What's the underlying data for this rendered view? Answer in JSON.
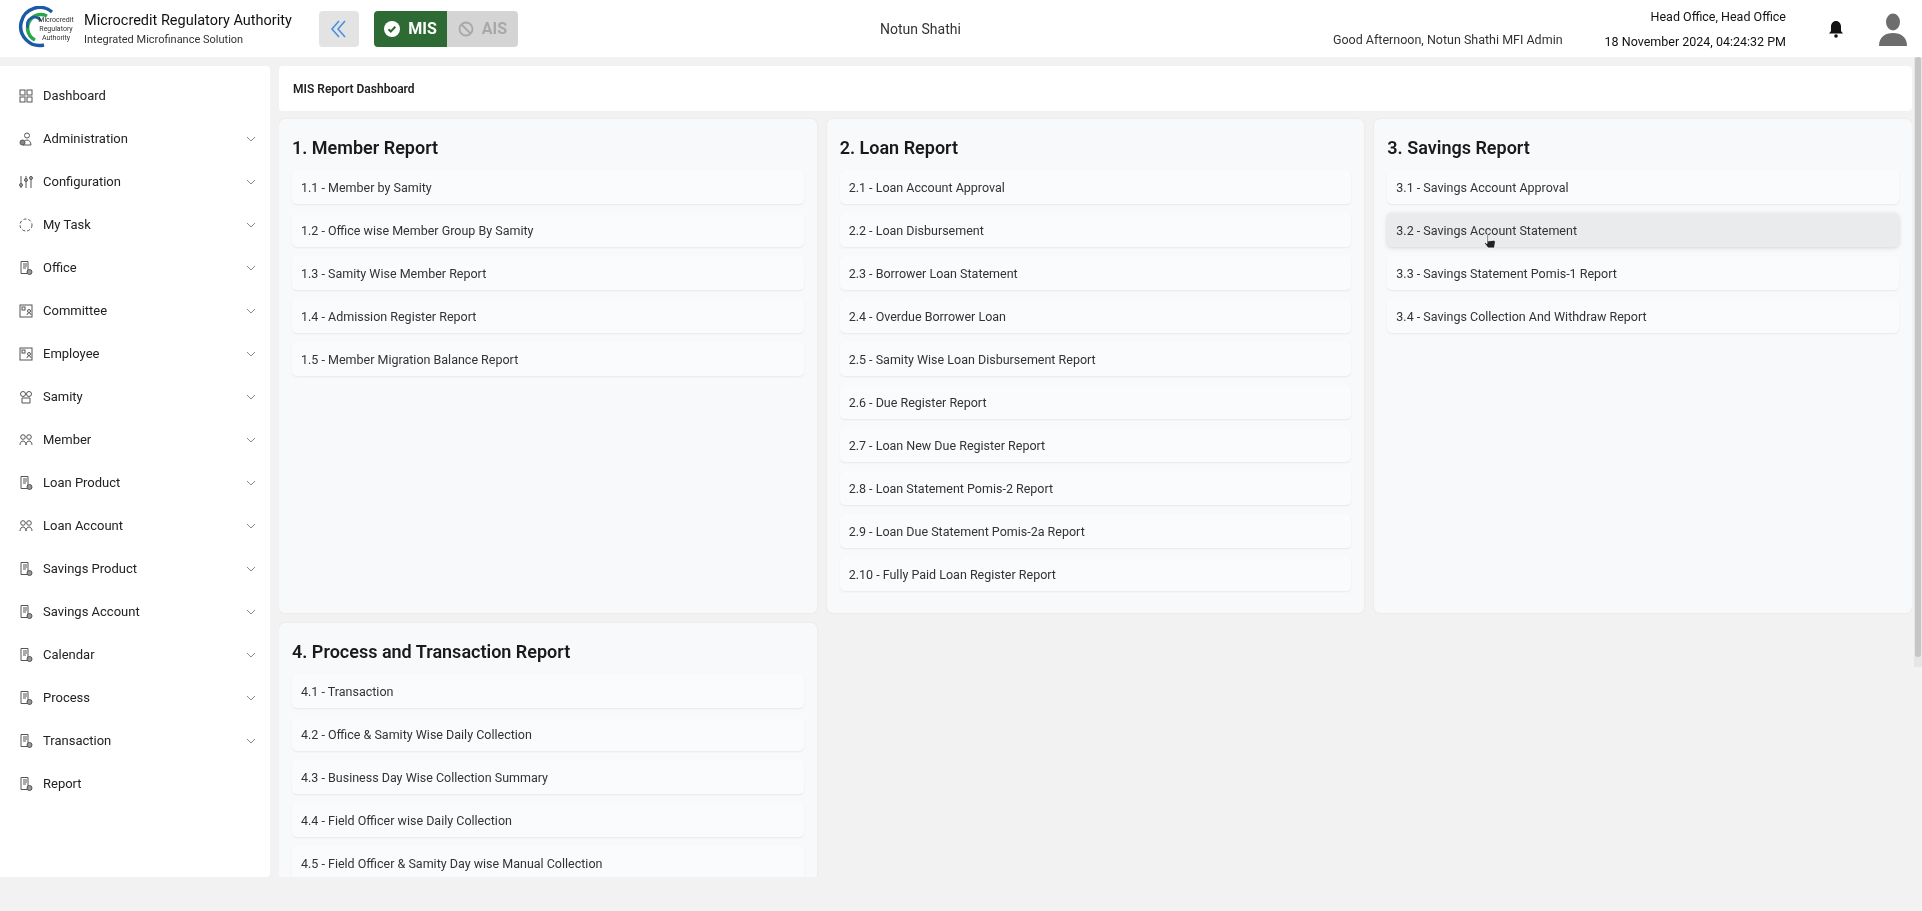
{
  "header": {
    "org_name": "Microcredit Regulatory Authority",
    "org_subtitle": "Integrated Microfinance Solution",
    "logo_text": "Microcredit Regulatory Authority",
    "modules": [
      {
        "label": "MIS",
        "selected": true
      },
      {
        "label": "AIS",
        "selected": false
      }
    ],
    "center_title": "Notun Shathi",
    "greeting": "Good Afternoon, Notun Shathi MFI Admin",
    "office": "Head Office, Head Office",
    "datetime": "18 November 2024, 04:24:32 PM"
  },
  "sidebar": {
    "items": [
      {
        "label": "Dashboard",
        "has_submenu": false
      },
      {
        "label": "Administration",
        "has_submenu": true
      },
      {
        "label": "Configuration",
        "has_submenu": true
      },
      {
        "label": "My Task",
        "has_submenu": true
      },
      {
        "label": "Office",
        "has_submenu": true
      },
      {
        "label": "Committee",
        "has_submenu": true
      },
      {
        "label": "Employee",
        "has_submenu": true
      },
      {
        "label": "Samity",
        "has_submenu": true
      },
      {
        "label": "Member",
        "has_submenu": true
      },
      {
        "label": "Loan Product",
        "has_submenu": true
      },
      {
        "label": "Loan Account",
        "has_submenu": true
      },
      {
        "label": "Savings Product",
        "has_submenu": true
      },
      {
        "label": "Savings Account",
        "has_submenu": true
      },
      {
        "label": "Calendar",
        "has_submenu": true
      },
      {
        "label": "Process",
        "has_submenu": true
      },
      {
        "label": "Transaction",
        "has_submenu": true
      },
      {
        "label": "Report",
        "has_submenu": false
      }
    ]
  },
  "page_title": "MIS Report Dashboard",
  "report_groups": [
    {
      "title": "1. Member Report",
      "items": [
        {
          "label": "1.1 - Member by Samity",
          "hovered": false
        },
        {
          "label": "1.2 - Office wise Member Group By Samity",
          "hovered": false
        },
        {
          "label": "1.3 - Samity Wise Member Report",
          "hovered": false
        },
        {
          "label": "1.4 - Admission Register Report",
          "hovered": false
        },
        {
          "label": "1.5 - Member Migration Balance Report",
          "hovered": false
        }
      ]
    },
    {
      "title": "2. Loan Report",
      "items": [
        {
          "label": "2.1 - Loan Account Approval",
          "hovered": false
        },
        {
          "label": "2.2 - Loan Disbursement",
          "hovered": false
        },
        {
          "label": "2.3 - Borrower Loan Statement",
          "hovered": false
        },
        {
          "label": "2.4 - Overdue Borrower Loan",
          "hovered": false
        },
        {
          "label": "2.5 - Samity Wise Loan Disbursement Report",
          "hovered": false
        },
        {
          "label": "2.6 - Due Register Report",
          "hovered": false
        },
        {
          "label": "2.7 - Loan New Due Register Report",
          "hovered": false
        },
        {
          "label": "2.8 - Loan Statement Pomis-2 Report",
          "hovered": false
        },
        {
          "label": "2.9 - Loan Due Statement Pomis-2a Report",
          "hovered": false
        },
        {
          "label": "2.10 - Fully Paid Loan Register Report",
          "hovered": false
        }
      ]
    },
    {
      "title": "3. Savings Report",
      "items": [
        {
          "label": "3.1 - Savings Account Approval",
          "hovered": false
        },
        {
          "label": "3.2 - Savings Account Statement",
          "hovered": true
        },
        {
          "label": "3.3 - Savings Statement Pomis-1 Report",
          "hovered": false
        },
        {
          "label": "3.4 - Savings Collection And Withdraw Report",
          "hovered": false
        }
      ]
    },
    {
      "title": "4. Process and Transaction Report",
      "items": [
        {
          "label": "4.1 - Transaction",
          "hovered": false
        },
        {
          "label": "4.2 - Office & Samity Wise Daily Collection",
          "hovered": false
        },
        {
          "label": "4.3 - Business Day Wise Collection Summary",
          "hovered": false
        },
        {
          "label": "4.4 - Field Officer wise Daily Collection",
          "hovered": false
        },
        {
          "label": "4.5 - Field Officer & Samity Day wise Manual Collection",
          "hovered": false
        }
      ]
    }
  ]
}
